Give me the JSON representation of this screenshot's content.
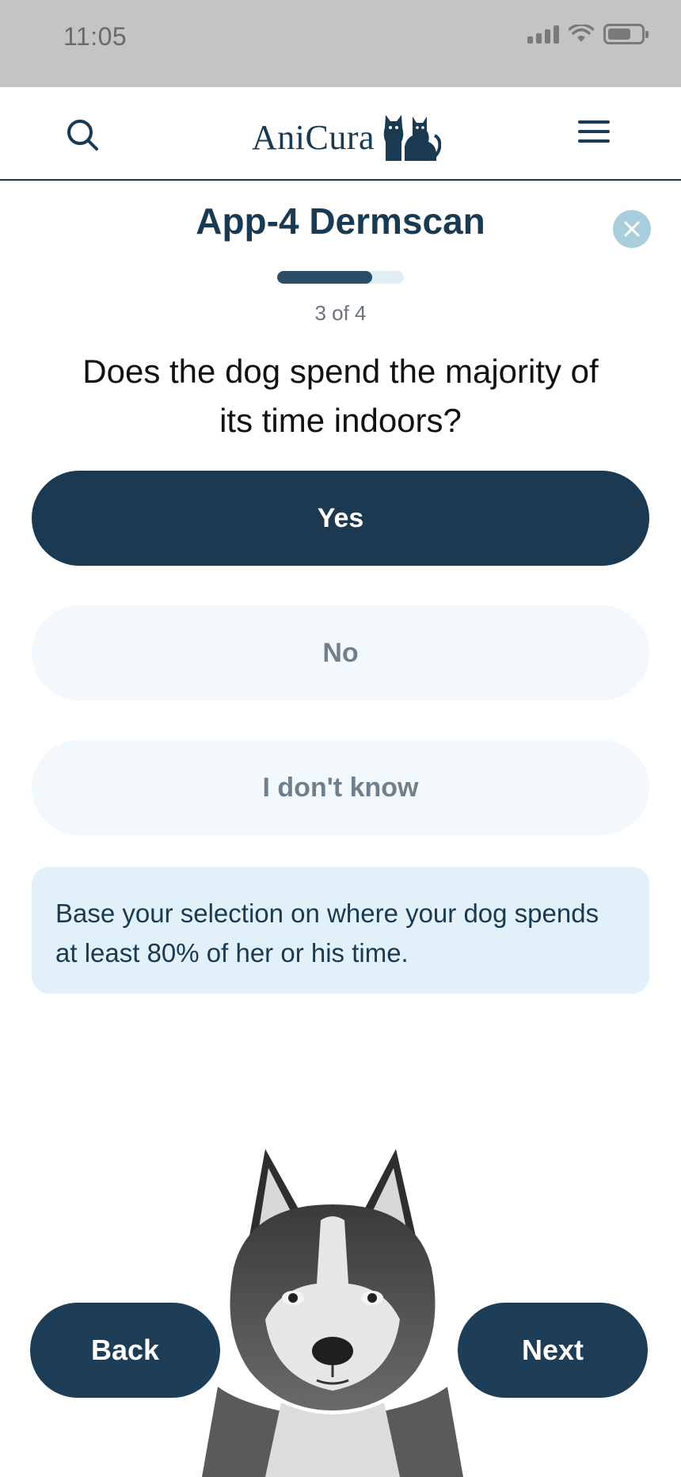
{
  "status_bar": {
    "time": "11:05",
    "icons": [
      "signal-icon",
      "wifi-icon",
      "battery-icon"
    ],
    "battery_level": 0.7
  },
  "header": {
    "logo_text": "AniCura",
    "search_icon": "search-icon",
    "menu_icon": "hamburger-menu-icon"
  },
  "quiz": {
    "title": "App-4 Dermscan",
    "progress": {
      "current": 3,
      "total": 4,
      "label": "3 of 4",
      "fraction": 0.75
    },
    "question": "Does the dog spend the majority of its time indoors?",
    "options": [
      {
        "label": "Yes",
        "selected": true
      },
      {
        "label": "No",
        "selected": false
      },
      {
        "label": "I don't know",
        "selected": false
      }
    ],
    "hint": "Base your selection on where your dog spends at least 80% of her or his time.",
    "back_label": "Back",
    "next_label": "Next"
  },
  "colors": {
    "primary": "#1b3a52",
    "option_unselected_bg": "#f3f8fc",
    "hint_bg": "#e2f0f9",
    "close_bg": "#a9cfdc",
    "status_bar_bg": "#c4c4c4"
  }
}
